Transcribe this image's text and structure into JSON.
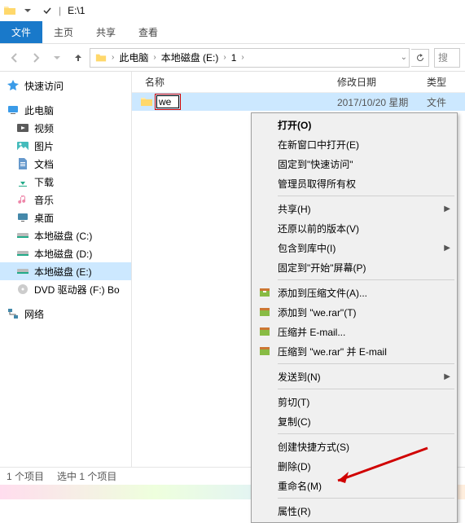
{
  "title_path": "E:\\1",
  "ribbon": {
    "file": "文件",
    "home": "主页",
    "share": "共享",
    "view": "查看"
  },
  "breadcrumb": [
    "此电脑",
    "本地磁盘 (E:)",
    "1"
  ],
  "search_placeholder": "搜",
  "columns": {
    "name": "名称",
    "modified": "修改日期",
    "type": "类型"
  },
  "items": [
    {
      "name": "we",
      "modified": "2017/10/20 星期",
      "type": "文件"
    }
  ],
  "sidebar": {
    "quick_access": "快速访问",
    "this_pc": "此电脑",
    "children": [
      "视频",
      "图片",
      "文档",
      "下载",
      "音乐",
      "桌面",
      "本地磁盘 (C:)",
      "本地磁盘 (D:)",
      "本地磁盘 (E:)",
      "DVD 驱动器 (F:) Bo"
    ],
    "network": "网络"
  },
  "status": {
    "count_label": "1 个项目",
    "selected_label": "选中 1 个项目"
  },
  "context_menu": {
    "open": "打开(O)",
    "open_new_window": "在新窗口中打开(E)",
    "pin_quick": "固定到\"快速访问\"",
    "admin_own": "管理员取得所有权",
    "share": "共享(H)",
    "restore_prev": "还原以前的版本(V)",
    "include_lib": "包含到库中(I)",
    "pin_start": "固定到\"开始\"屏幕(P)",
    "add_archive": "添加到压缩文件(A)...",
    "add_to_rar": "添加到 \"we.rar\"(T)",
    "compress_email": "压缩并 E-mail...",
    "compress_to_email": "压缩到 \"we.rar\" 并 E-mail",
    "send_to": "发送到(N)",
    "cut": "剪切(T)",
    "copy": "复制(C)",
    "create_shortcut": "创建快捷方式(S)",
    "delete": "删除(D)",
    "rename": "重命名(M)",
    "properties": "属性(R)"
  }
}
